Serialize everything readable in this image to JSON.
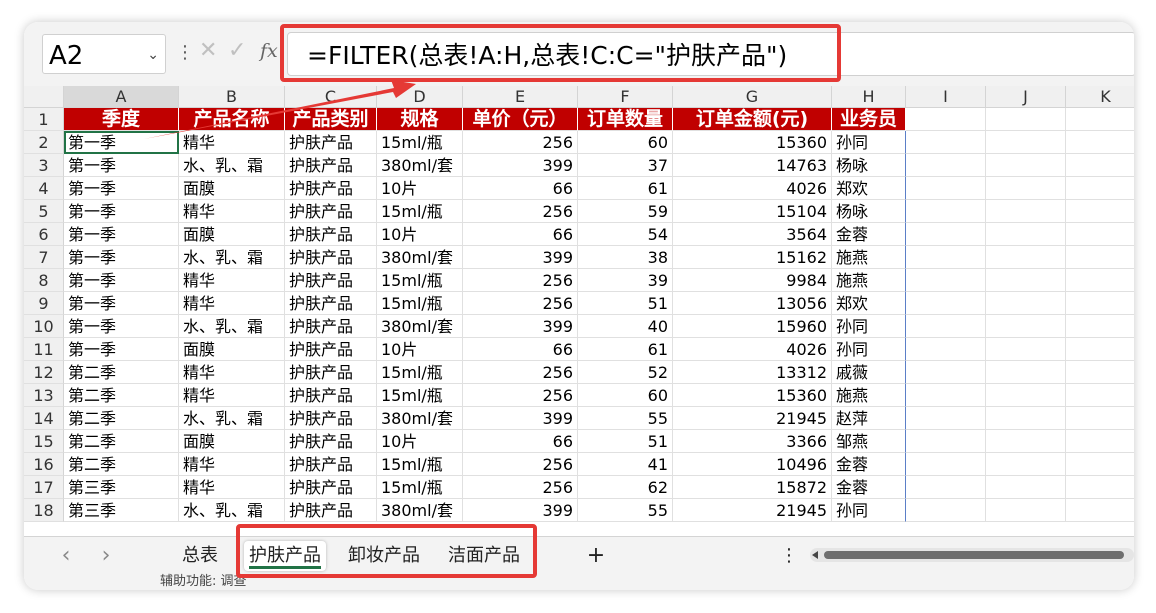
{
  "formula_bar": {
    "name_box": "A2",
    "formula": "=FILTER(总表!A:H,总表!C:C=\"护肤产品\")",
    "fx_label": "fx"
  },
  "grid": {
    "columns": [
      "A",
      "B",
      "C",
      "D",
      "E",
      "F",
      "G",
      "H",
      "I",
      "J",
      "K"
    ],
    "headers": [
      "季度",
      "产品名称",
      "产品类别",
      "规格",
      "单价（元）",
      "订单数量",
      "订单金额(元)",
      "业务员"
    ],
    "rows": [
      [
        "第一季",
        "精华",
        "护肤产品",
        "15ml/瓶",
        "256",
        "60",
        "15360",
        "孙同"
      ],
      [
        "第一季",
        "水、乳、霜",
        "护肤产品",
        "380ml/套",
        "399",
        "37",
        "14763",
        "杨咏"
      ],
      [
        "第一季",
        "面膜",
        "护肤产品",
        "10片",
        "66",
        "61",
        "4026",
        "郑欢"
      ],
      [
        "第一季",
        "精华",
        "护肤产品",
        "15ml/瓶",
        "256",
        "59",
        "15104",
        "杨咏"
      ],
      [
        "第一季",
        "面膜",
        "护肤产品",
        "10片",
        "66",
        "54",
        "3564",
        "金蓉"
      ],
      [
        "第一季",
        "水、乳、霜",
        "护肤产品",
        "380ml/套",
        "399",
        "38",
        "15162",
        "施燕"
      ],
      [
        "第一季",
        "精华",
        "护肤产品",
        "15ml/瓶",
        "256",
        "39",
        "9984",
        "施燕"
      ],
      [
        "第一季",
        "精华",
        "护肤产品",
        "15ml/瓶",
        "256",
        "51",
        "13056",
        "郑欢"
      ],
      [
        "第一季",
        "水、乳、霜",
        "护肤产品",
        "380ml/套",
        "399",
        "40",
        "15960",
        "孙同"
      ],
      [
        "第一季",
        "面膜",
        "护肤产品",
        "10片",
        "66",
        "61",
        "4026",
        "孙同"
      ],
      [
        "第二季",
        "精华",
        "护肤产品",
        "15ml/瓶",
        "256",
        "52",
        "13312",
        "戚薇"
      ],
      [
        "第二季",
        "精华",
        "护肤产品",
        "15ml/瓶",
        "256",
        "60",
        "15360",
        "施燕"
      ],
      [
        "第二季",
        "水、乳、霜",
        "护肤产品",
        "380ml/套",
        "399",
        "55",
        "21945",
        "赵萍"
      ],
      [
        "第二季",
        "面膜",
        "护肤产品",
        "10片",
        "66",
        "51",
        "3366",
        "邹燕"
      ],
      [
        "第二季",
        "精华",
        "护肤产品",
        "15ml/瓶",
        "256",
        "41",
        "10496",
        "金蓉"
      ],
      [
        "第三季",
        "精华",
        "护肤产品",
        "15ml/瓶",
        "256",
        "62",
        "15872",
        "金蓉"
      ],
      [
        "第三季",
        "水、乳、霜",
        "护肤产品",
        "380ml/套",
        "399",
        "55",
        "21945",
        "孙同"
      ]
    ]
  },
  "sheet_tabs": {
    "prev": "‹",
    "next": "›",
    "tabs": [
      "总表",
      "护肤产品",
      "卸妆产品",
      "洁面产品"
    ],
    "active_index": 1,
    "add": "+",
    "more": "⋮"
  },
  "status_bar": {
    "accessibility": "辅助功能: 调查"
  },
  "colors": {
    "header_fill": "#c00000",
    "highlight": "#e53935",
    "active_cell": "#217346"
  }
}
